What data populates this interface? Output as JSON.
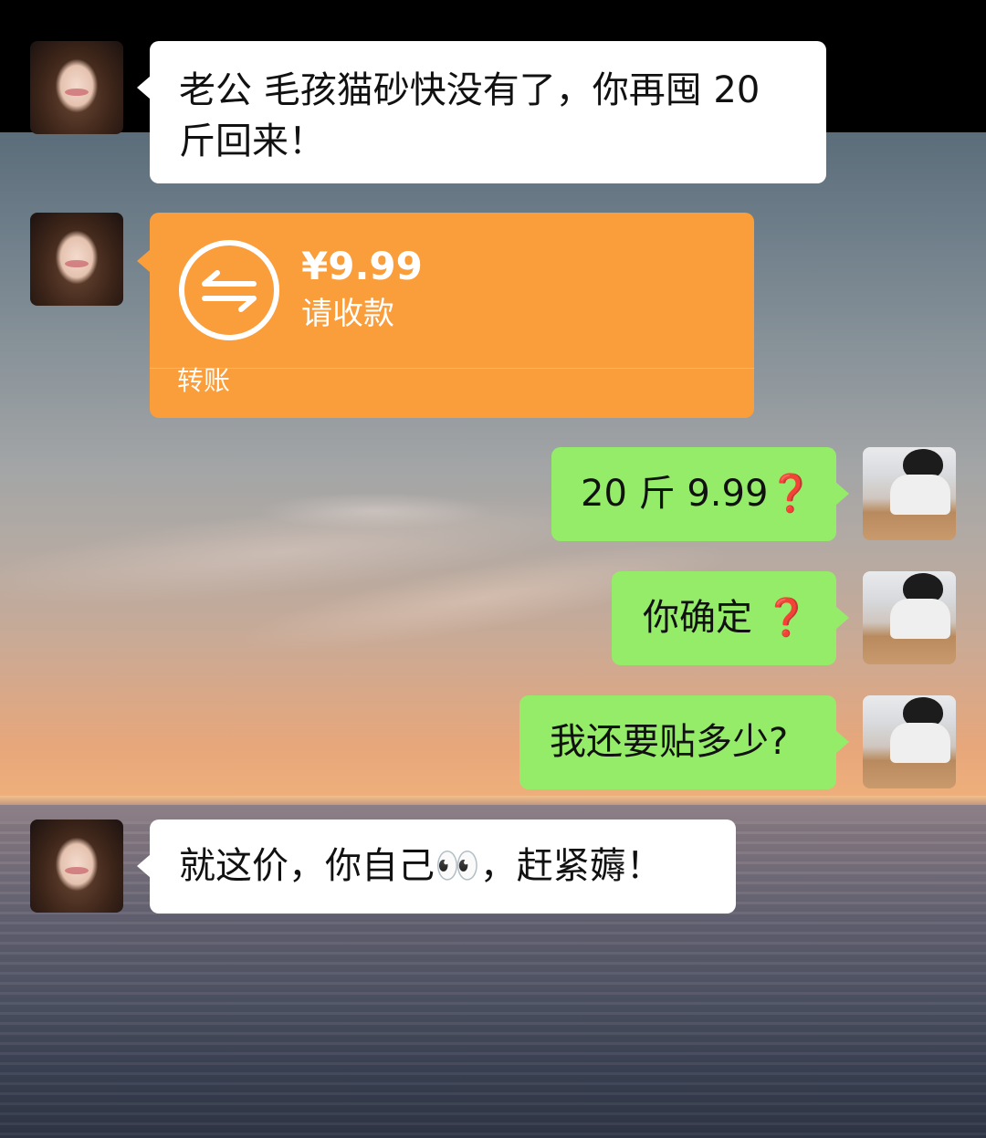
{
  "messages": [
    {
      "sender": "wife",
      "text": "老公 毛孩猫砂快没有了，你再囤 20 斤回来！"
    },
    {
      "sender": "wife",
      "type": "transfer",
      "amount": "¥9.99",
      "status": "请收款",
      "label": "转账",
      "icon": "transfer-arrows-icon"
    },
    {
      "sender": "me",
      "text": "20 斤 9.99",
      "suffix": "❓"
    },
    {
      "sender": "me",
      "text": "你确定 ",
      "suffix": "❓"
    },
    {
      "sender": "me",
      "text": "我还要贴多少?"
    },
    {
      "sender": "wife",
      "text": "就这价，你自己👀，赶紧薅！"
    }
  ],
  "colors": {
    "incoming_bubble": "#ffffff",
    "outgoing_bubble": "#95ec69",
    "transfer_card": "#fa9d3b",
    "question_mark": "#e0201a"
  }
}
